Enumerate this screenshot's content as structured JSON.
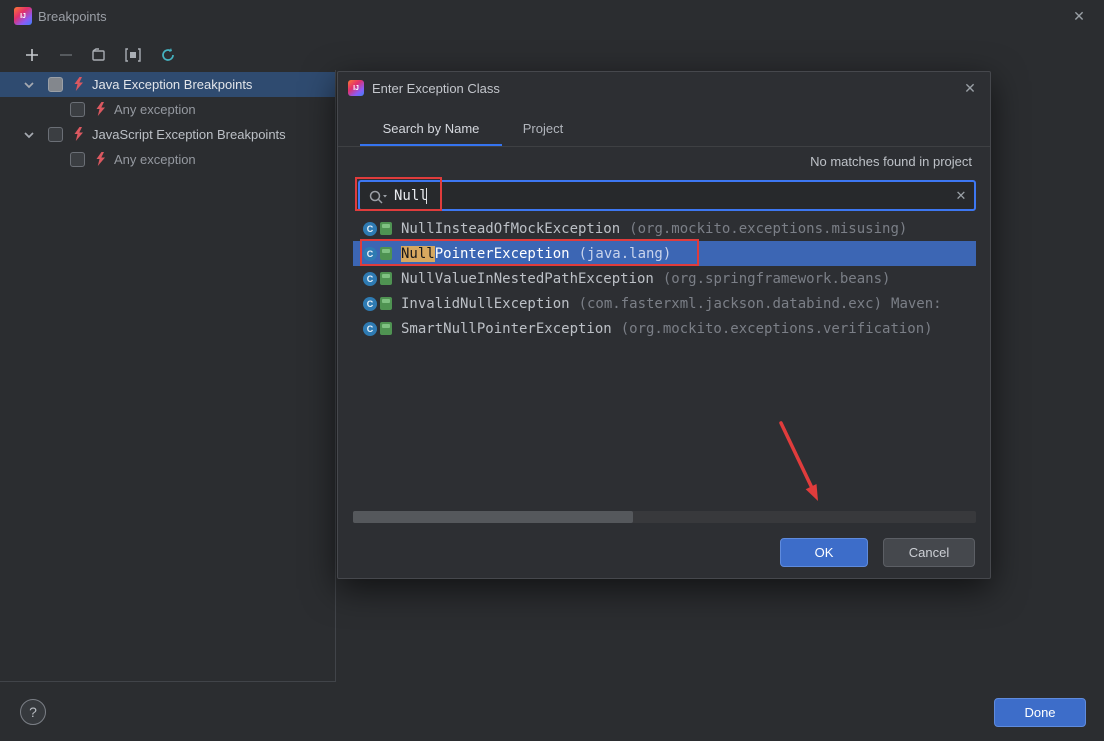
{
  "window": {
    "title": "Breakpoints",
    "close_label": "✕"
  },
  "toolbar": {
    "icons": [
      "add",
      "remove",
      "group-by-file",
      "group-by-class",
      "group-by-package"
    ]
  },
  "tree": {
    "groups": [
      {
        "label": "Java Exception Breakpoints",
        "checked": false,
        "expanded": true,
        "selected": true,
        "children": [
          {
            "label": "Any exception",
            "checked": false
          }
        ]
      },
      {
        "label": "JavaScript Exception Breakpoints",
        "checked": false,
        "expanded": true,
        "selected": false,
        "children": [
          {
            "label": "Any exception",
            "checked": false
          }
        ]
      }
    ]
  },
  "dialog": {
    "title": "Enter Exception Class",
    "close_label": "✕",
    "tabs": [
      {
        "label": "Search by Name",
        "active": true
      },
      {
        "label": "Project",
        "active": false
      }
    ],
    "status_text": "No matches found in project",
    "search": {
      "value": "Null",
      "clear_label": "✕"
    },
    "results": [
      {
        "name": "NullInsteadOfMockException",
        "package": "(org.mockito.exceptions.misusing)",
        "selected": false
      },
      {
        "match": "Null",
        "name_rest": "PointerException",
        "package": "(java.lang)",
        "selected": true
      },
      {
        "name": "NullValueInNestedPathException",
        "package": "(org.springframework.beans)",
        "selected": false
      },
      {
        "name": "InvalidNullException",
        "package": "(com.fasterxml.jackson.databind.exc)",
        "origin": "Maven:",
        "selected": false
      },
      {
        "name": "SmartNullPointerException",
        "package": "(org.mockito.exceptions.verification)",
        "selected": false
      }
    ],
    "ok_label": "OK",
    "cancel_label": "Cancel"
  },
  "footer": {
    "help_label": "?",
    "done_label": "Done"
  },
  "colors": {
    "window_bg": "#2b2d30",
    "accent_blue": "#3574f0",
    "list_selection_blue": "#3c66b4",
    "tree_selection_blue": "#2f4b70",
    "match_highlight": "#d7a85f",
    "button_blue": "#3d6dc9",
    "annotation_red": "#e03c3c"
  }
}
